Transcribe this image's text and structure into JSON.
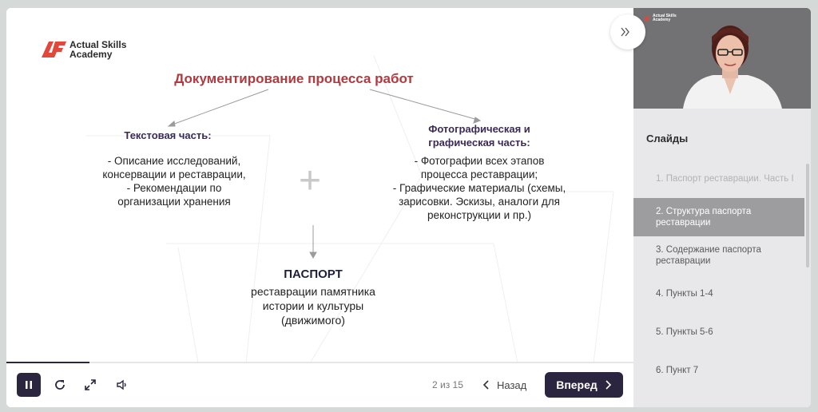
{
  "brand": {
    "line1": "Actual Skills",
    "line2": "Academy"
  },
  "slide": {
    "title": "Документирование процесса работ",
    "left_title": "Текстовая часть:",
    "left_lines": [
      "- Описание исследований,",
      "консервации и реставрации,",
      "- Рекомендации по",
      "организации хранения"
    ],
    "plus_symbol": "+",
    "right_title_lines": [
      "Фотографическая и",
      "графическая часть:"
    ],
    "right_lines": [
      "- Фотографии всех этапов",
      "процесса реставрации;",
      "- Графические материалы (схемы,",
      "зарисовки. Эскизы, аналоги для",
      "реконструкции и пр.)"
    ],
    "passport_title": "ПАСПОРТ",
    "passport_lines": [
      "реставрации памятника",
      "истории и культуры",
      "(движимого)"
    ]
  },
  "player": {
    "progress": 0.133,
    "counter": "2 из 15",
    "back_label": "Назад",
    "next_label": "Вперед"
  },
  "sidebar": {
    "heading": "Слайды",
    "items": [
      {
        "label": "1. Паспорт реставрации. Часть I",
        "state": "dim"
      },
      {
        "label": "2. Структура паспорта реставрации",
        "state": "active"
      },
      {
        "label": "3. Содержание паспорта реставрации",
        "state": "normal"
      },
      {
        "label": "4. Пункты 1-4",
        "state": "normal"
      },
      {
        "label": "5. Пункты 5-6",
        "state": "normal"
      },
      {
        "label": "6. Пункт 7",
        "state": "normal"
      }
    ]
  },
  "colors": {
    "accent": "#2b2540",
    "brand_red": "#e2473c",
    "title_red": "#b23a3f"
  },
  "icons": [
    "pause-icon",
    "replay-icon",
    "fullscreen-icon",
    "volume-icon",
    "chevron-left-icon",
    "chevron-right-icon",
    "collapse-sidebar-icon"
  ]
}
